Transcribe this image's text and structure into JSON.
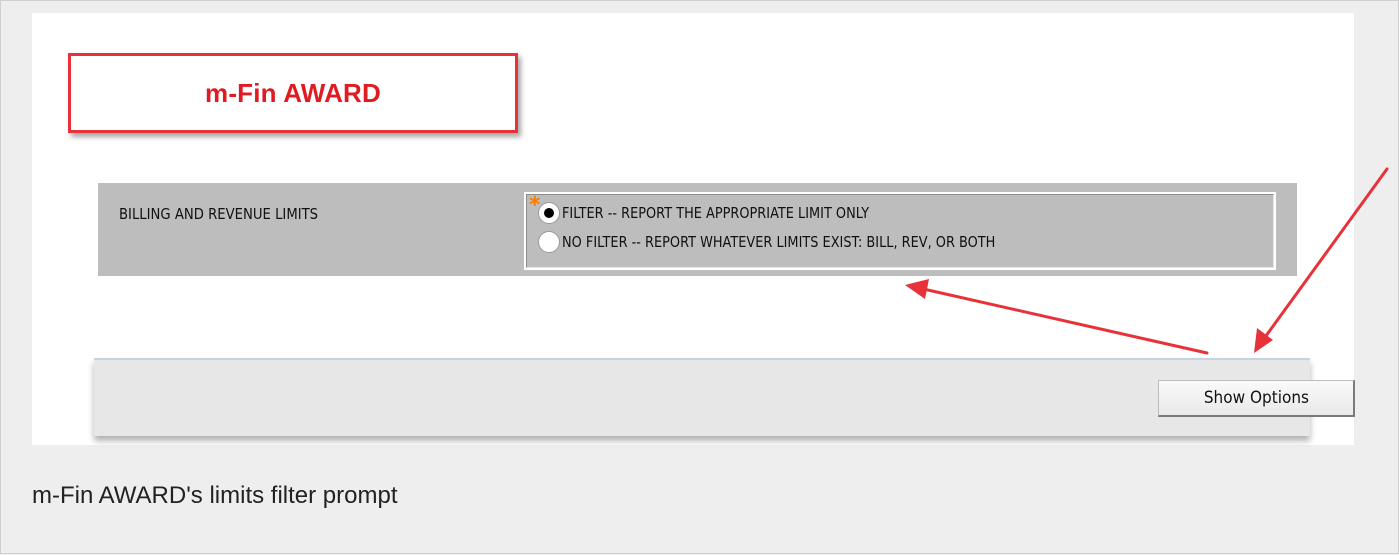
{
  "title": {
    "text": "m-Fin AWARD",
    "color": "#e01b22",
    "border_color": "#e8323a"
  },
  "prompt": {
    "label": "BILLING AND REVENUE LIMITS",
    "required_marker": "*",
    "options": [
      {
        "label": "FILTER -- REPORT THE APPROPRIATE LIMIT ONLY",
        "selected": true
      },
      {
        "label": "NO FILTER -- REPORT WHATEVER LIMITS EXIST:  BILL, REV, OR BOTH",
        "selected": false
      }
    ]
  },
  "toolbar": {
    "show_options_label": "Show Options"
  },
  "annotations": {
    "arrow_color": "#e8323a",
    "icons": [
      "arrow-to-options-icon",
      "arrow-to-button-icon"
    ]
  },
  "caption": {
    "text": "m-Fin AWARD's limits filter prompt"
  }
}
